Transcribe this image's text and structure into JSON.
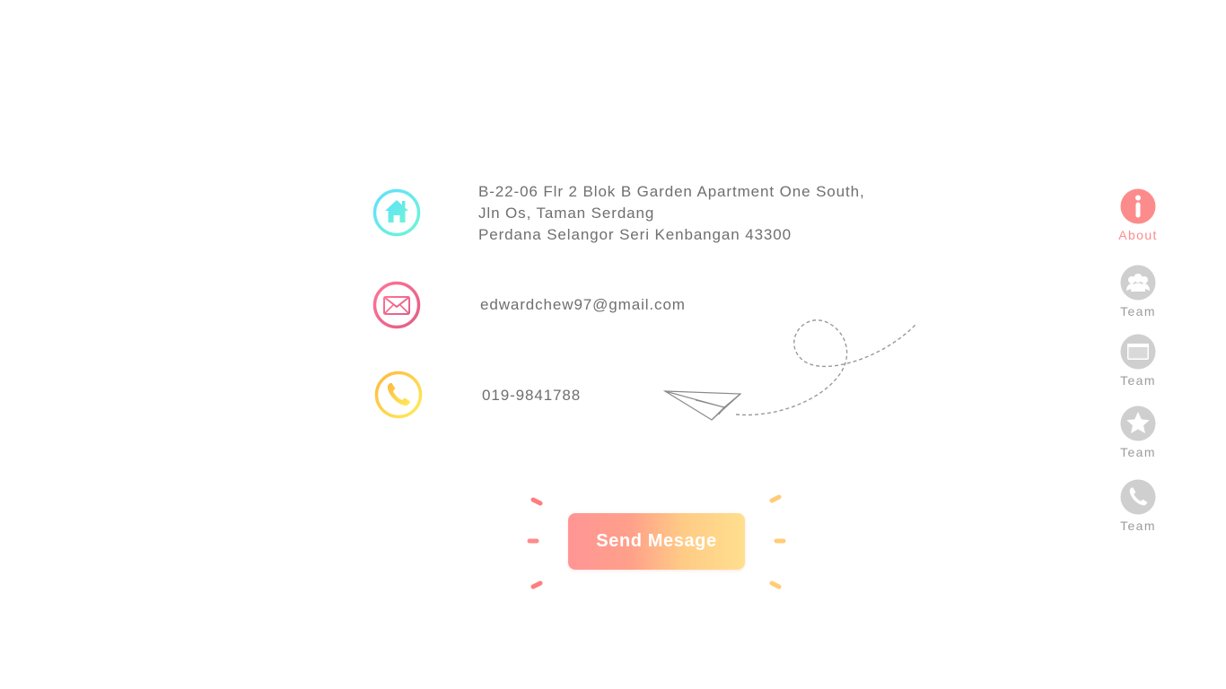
{
  "contact": {
    "address_lines": [
      "B-22-06 Flr 2 Blok B Garden Apartment One South,",
      "Jln Os, Taman Serdang",
      "Perdana Selangor Seri Kenbangan 43300"
    ],
    "email": "edwardchew97@gmail.com",
    "phone": "019-9841788",
    "icons": [
      "home-icon",
      "envelope-icon",
      "phone-icon"
    ]
  },
  "send_button": {
    "label": "Send Mesage"
  },
  "side_nav": {
    "items": [
      {
        "label": "About",
        "icon": "info-icon",
        "active": true
      },
      {
        "label": "Team",
        "icon": "team-icon",
        "active": false
      },
      {
        "label": "Team",
        "icon": "folder-icon",
        "active": false
      },
      {
        "label": "Team",
        "icon": "star-icon",
        "active": false
      },
      {
        "label": "Team",
        "icon": "phone-icon",
        "active": false
      }
    ]
  },
  "colors": {
    "text": "#6f6f6f",
    "nav_active": "#fc8c8c",
    "nav_inactive": "#cfcfcf",
    "home_gradient": [
      "#63e3ff",
      "#6af2d8"
    ],
    "mail_gradient": [
      "#ff6e8c",
      "#e8608a"
    ],
    "phone_gradient": [
      "#ffbf40",
      "#ffe857"
    ]
  }
}
